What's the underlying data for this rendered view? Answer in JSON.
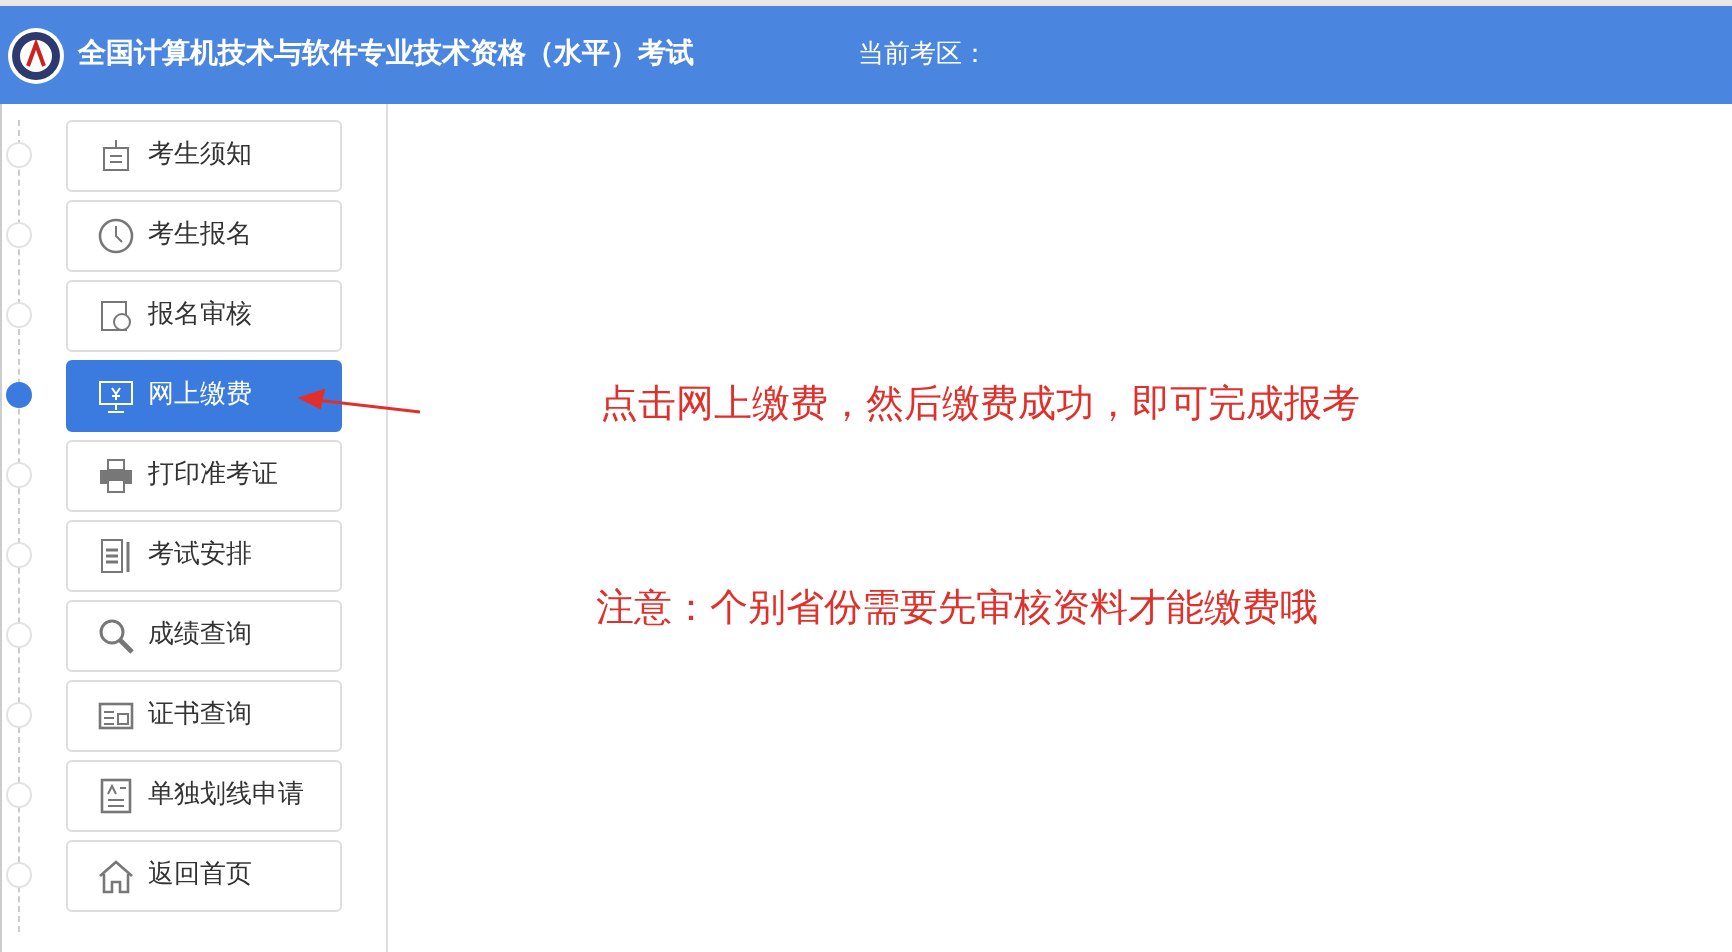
{
  "header": {
    "title": "全国计算机技术与软件专业技术资格（水平）考试",
    "region_label": "当前考区："
  },
  "sidebar": {
    "items": [
      {
        "label": "考生须知",
        "selected": false
      },
      {
        "label": "考生报名",
        "selected": false
      },
      {
        "label": "报名审核",
        "selected": false
      },
      {
        "label": "网上缴费",
        "selected": true
      },
      {
        "label": "打印准考证",
        "selected": false
      },
      {
        "label": "考试安排",
        "selected": false
      },
      {
        "label": "成绩查询",
        "selected": false
      },
      {
        "label": "证书查询",
        "selected": false
      },
      {
        "label": "单独划线申请",
        "selected": false
      },
      {
        "label": "返回首页",
        "selected": false
      }
    ]
  },
  "annotations": [
    {
      "text": "点击网上缴费，然后缴费成功，即可完成报考"
    },
    {
      "text": "注意：个别省份需要先审核资料才能缴费哦"
    }
  ]
}
